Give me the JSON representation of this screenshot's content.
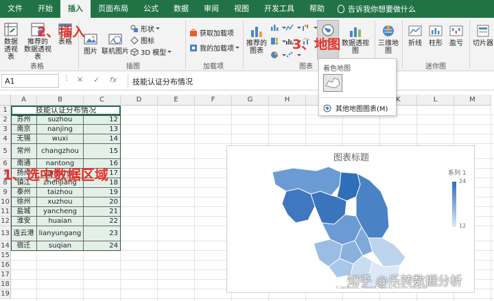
{
  "tabs": [
    "文件",
    "开始",
    "插入",
    "页面布局",
    "公式",
    "数据",
    "审阅",
    "视图",
    "开发工具",
    "帮助"
  ],
  "active_tab": "插入",
  "tell_me": "告诉我你想要做什么",
  "ribbon": {
    "tables": {
      "pivot": "数据\n透视表",
      "rec_pivot": "推荐的\n数据透视表",
      "table": "表格",
      "label": "表格"
    },
    "illustrations": {
      "picture": "图片",
      "online_picture": "联机图片",
      "shapes": "形状",
      "icons": "图标",
      "model3d": "3D 模型",
      "label": "插图"
    },
    "addins": {
      "get": "获取加载项",
      "mine": "我的加载项",
      "label": "加载项"
    },
    "charts": {
      "recommended": "推荐的\n图表",
      "maps": "地图",
      "pivot_chart": "数据透视图",
      "label": "图表"
    },
    "tours": {
      "map3d": "三维地\n图"
    },
    "sparklines": {
      "line": "折线",
      "column": "柱形",
      "winloss": "盈亏",
      "label": "迷你图"
    },
    "slicer": "切片器"
  },
  "formula_bar": {
    "name_box": "A1",
    "fx": "fx",
    "content": "技能认证分布情况"
  },
  "columns": [
    "A",
    "B",
    "C",
    "D",
    "E",
    "F",
    "G",
    "H",
    "I",
    "J",
    "K",
    "L",
    "M"
  ],
  "rows": [
    "1",
    "2",
    "3",
    "4",
    "5",
    "6",
    "7",
    "8",
    "9",
    "10",
    "11",
    "12",
    "13",
    "14",
    "15",
    "16",
    "17",
    "18",
    "19"
  ],
  "table": {
    "title": "技能认证分布情况",
    "rows": [
      [
        "苏州",
        "suzhou",
        "12"
      ],
      [
        "南京",
        "nanjing",
        "13"
      ],
      [
        "无锡",
        "wuxi",
        "14"
      ],
      [
        "常州",
        "changzhou",
        "15"
      ],
      [
        "南通",
        "nantong",
        "16"
      ],
      [
        "扬州",
        "yangzhou",
        "17"
      ],
      [
        "镇江",
        "zhenjiang",
        "18"
      ],
      [
        "泰州",
        "taizhou",
        "19"
      ],
      [
        "徐州",
        "xuzhou",
        "20"
      ],
      [
        "盐城",
        "yancheng",
        "21"
      ],
      [
        "淮安",
        "huaian",
        "22"
      ],
      [
        "连云港",
        "lianyungang",
        "23"
      ],
      [
        "宿迁",
        "suqian",
        "24"
      ]
    ]
  },
  "chart": {
    "title": "图表标题",
    "legend_name": "系列 1",
    "legend_max": "24",
    "legend_min": "12",
    "credit": "© GeoNames, Microsoft, Navinfo, TomTom, Wikipedia"
  },
  "dropdown": {
    "header": "着色地图",
    "more": "其他地图图表(M)"
  },
  "annotations": {
    "step1": "1、选中数据区域",
    "step2": "2、插入",
    "step3": "3、地图"
  },
  "watermark": "知乎 @乐转数据分析",
  "colors": {
    "excel_green": "#217346",
    "annotation_red": "#e8312c",
    "table_fill": "#e2f0e8",
    "map_dark": "#2e6fb8",
    "map_light": "#dbe8f6"
  }
}
